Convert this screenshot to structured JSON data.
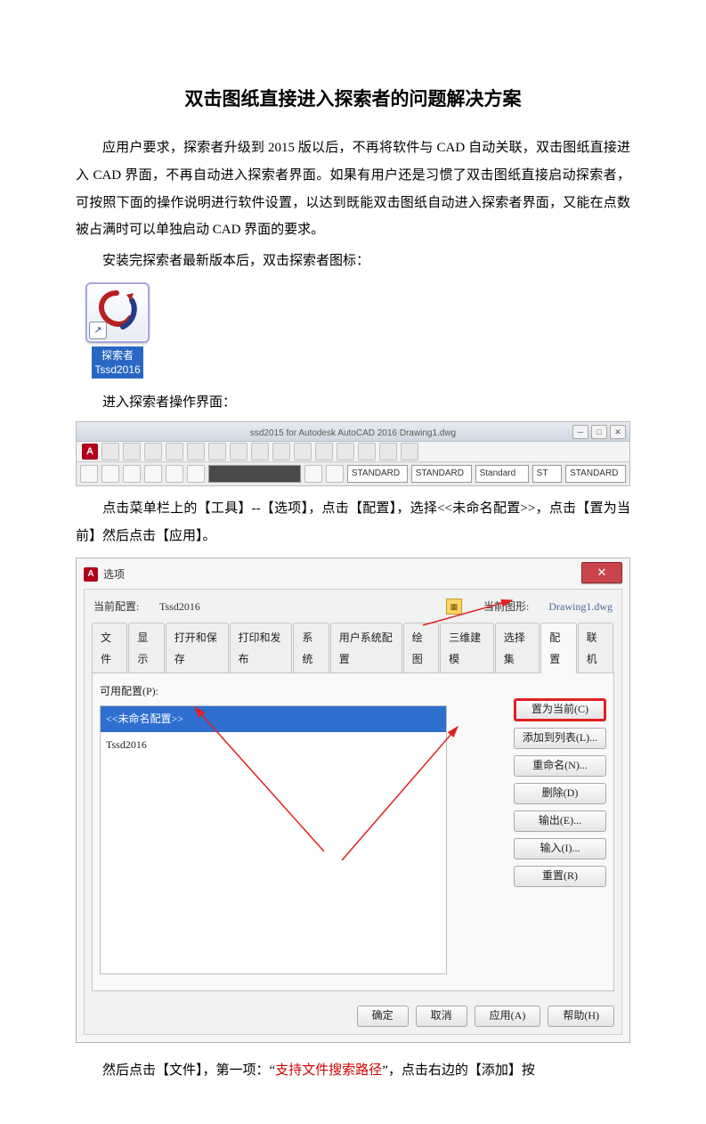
{
  "title": "双击图纸直接进入探索者的问题解决方案",
  "para1": "应用户要求，探索者升级到 2015 版以后，不再将软件与 CAD 自动关联，双击图纸直接进入 CAD 界面，不再自动进入探索者界面。如果有用户还是习惯了双击图纸直接启动探索者，可按照下面的操作说明进行软件设置，以达到既能双击图纸自动进入探索者界面，又能在点数被占满时可以单独启动 CAD 界面的要求。",
  "para2": "安装完探索者最新版本后，双击探索者图标：",
  "iconLabel1": "探索者",
  "iconLabel2": "Tssd2016",
  "para3": "进入探索者操作界面：",
  "para4": "点击菜单栏上的【工具】--【选项】，点击【配置】，选择<<未命名配置>>，点击【置为当前】然后点击【应用】。",
  "para5_pre": "然后点击【文件】，第一项：“",
  "para5_red": "支持文件搜索路径",
  "para5_post": "”，点击右边的【添加】按",
  "strip": {
    "title": "ssd2015 for Autodesk AutoCAD 2016    Drawing1.dwg",
    "combo1": "STANDARD",
    "combo2": "STANDARD",
    "combo3": "Standard",
    "combo4": "ST",
    "combo5": "STANDARD"
  },
  "dlg": {
    "windowTitle": "选项",
    "topLeftLabel": "当前配置:",
    "topMid": "Tssd2016",
    "topRightLabel": "当前图形:",
    "fileName": "Drawing1.dwg",
    "tabs": [
      "文件",
      "显示",
      "打开和保存",
      "打印和发布",
      "系统",
      "用户系统配置",
      "绘图",
      "三维建模",
      "选择集",
      "配置",
      "联机"
    ],
    "activeTabIndex": 9,
    "panelLabel": "可用配置(P):",
    "listSel": "<<未命名配置>>",
    "listItem": "Tssd2016",
    "sideButtons": [
      "置为当前(C)",
      "添加到列表(L)...",
      "重命名(N)...",
      "删除(D)",
      "输出(E)...",
      "输入(I)...",
      "重置(R)"
    ],
    "bottom": [
      "确定",
      "取消",
      "应用(A)",
      "帮助(H)"
    ]
  }
}
